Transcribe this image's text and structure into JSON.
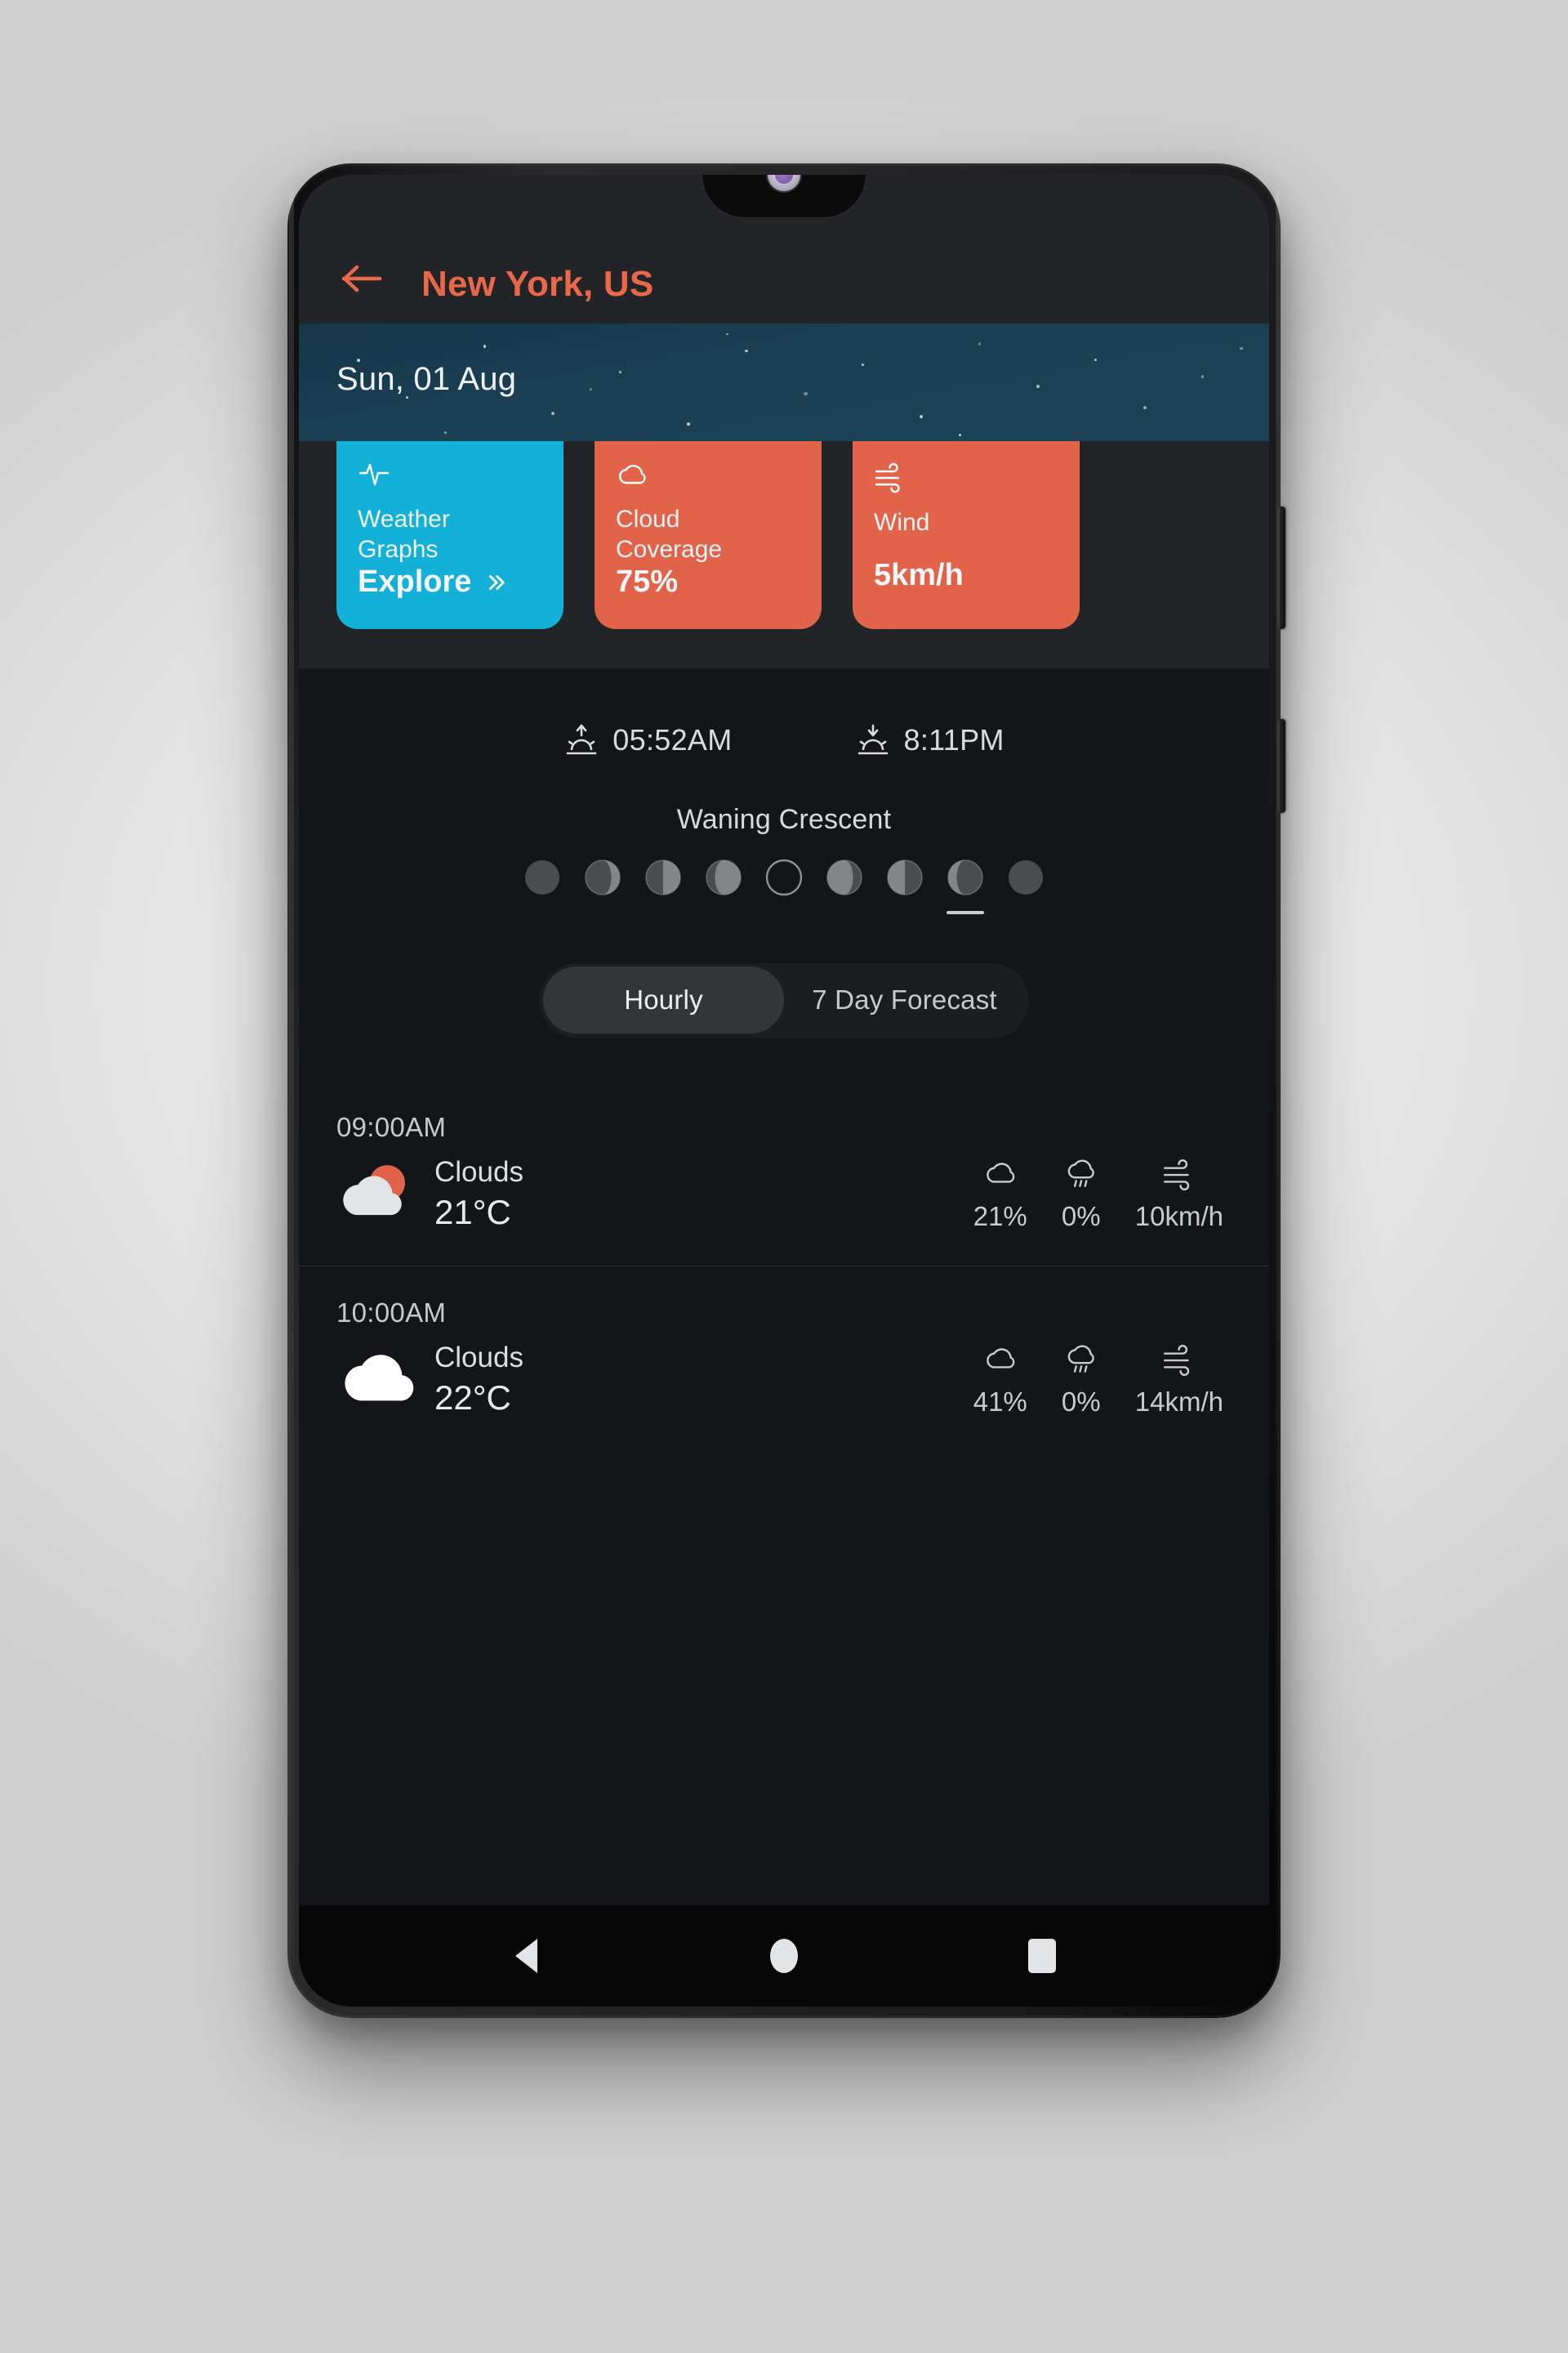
{
  "app": {
    "accent_color": "#e8684a",
    "card_blue": "#13b0d8",
    "card_red": "#e1634a",
    "banner_color": "#1a4054",
    "background": "#141518"
  },
  "topbar": {
    "back_icon": "arrow-left-icon",
    "title": "New York, US"
  },
  "date_banner": {
    "date": "Sun, 01 Aug"
  },
  "highlight_cards": [
    {
      "icon": "activity-pulse-icon",
      "title": "Weather\nGraphs",
      "value": "Explore",
      "value_suffix_icon": "chevron-double-right-icon",
      "bg": "#13b0d8"
    },
    {
      "icon": "cloud-icon",
      "title": "Cloud\nCoverage",
      "value": "75%",
      "value_suffix_icon": "",
      "bg": "#e1634a"
    },
    {
      "icon": "wind-icon",
      "title": "Wind",
      "value": "5km/h",
      "value_suffix_icon": "",
      "bg": "#e1634a"
    }
  ],
  "sun_times": {
    "sunrise": {
      "icon": "sunrise-icon",
      "time": "05:52AM"
    },
    "sunset": {
      "icon": "sunset-icon",
      "time": "8:11PM"
    }
  },
  "moon": {
    "label": "Waning Crescent",
    "phases": [
      {
        "name": "new-moon",
        "illum": 0.0,
        "lit": "none",
        "selected": false
      },
      {
        "name": "waxing-crescent",
        "illum": 0.25,
        "lit": "right",
        "selected": false
      },
      {
        "name": "first-quarter",
        "illum": 0.5,
        "lit": "right",
        "selected": false
      },
      {
        "name": "waxing-gibbous",
        "illum": 0.75,
        "lit": "right",
        "selected": false
      },
      {
        "name": "full-moon",
        "illum": 1.0,
        "lit": "full",
        "selected": false
      },
      {
        "name": "waning-gibbous",
        "illum": 0.75,
        "lit": "left",
        "selected": false
      },
      {
        "name": "last-quarter",
        "illum": 0.5,
        "lit": "left",
        "selected": false
      },
      {
        "name": "waning-crescent",
        "illum": 0.25,
        "lit": "left",
        "selected": true
      },
      {
        "name": "dark-moon",
        "illum": 0.0,
        "lit": "none",
        "selected": false
      }
    ],
    "selected_index": 7
  },
  "forecast_toggle": {
    "options": [
      {
        "label": "Hourly",
        "active": true
      },
      {
        "label": "7 Day Forecast",
        "active": false
      }
    ]
  },
  "forecast": {
    "rows": [
      {
        "time": "09:00AM",
        "weather_icon": "cloud-sun-icon",
        "condition": "Clouds",
        "temperature": "21°C",
        "metrics": [
          {
            "icon": "cloud-icon",
            "value": "21%"
          },
          {
            "icon": "rain-icon",
            "value": "0%"
          },
          {
            "icon": "wind-icon",
            "value": "10km/h"
          }
        ]
      },
      {
        "time": "10:00AM",
        "weather_icon": "cloud-icon-filled",
        "condition": "Clouds",
        "temperature": "22°C",
        "metrics": [
          {
            "icon": "cloud-icon",
            "value": "41%"
          },
          {
            "icon": "rain-icon",
            "value": "0%"
          },
          {
            "icon": "wind-icon",
            "value": "14km/h"
          }
        ]
      }
    ]
  },
  "navbar": {
    "back": "back-triangle-icon",
    "home": "home-circle-icon",
    "recents": "recents-square-icon"
  }
}
